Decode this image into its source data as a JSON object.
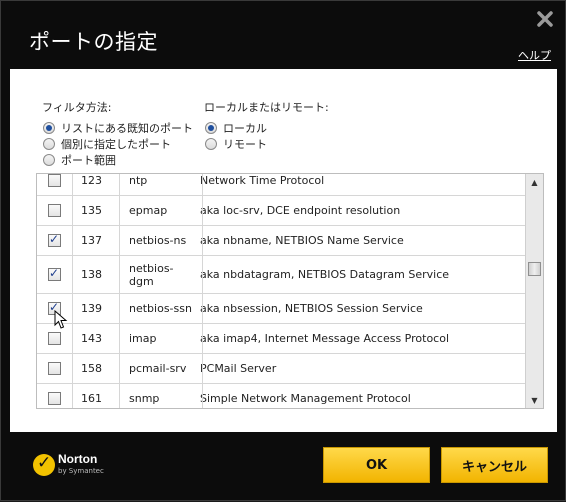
{
  "dialog": {
    "title": "ポートの指定",
    "help_label": "ヘルプ",
    "close_icon": "close-icon"
  },
  "filter": {
    "label": "フィルタ方法:",
    "options": [
      {
        "label": "リストにある既知のポート",
        "selected": true
      },
      {
        "label": "個別に指定したポート",
        "selected": false
      },
      {
        "label": "ポート範囲",
        "selected": false
      }
    ]
  },
  "scope": {
    "label": "ローカルまたはリモート:",
    "options": [
      {
        "label": "ローカル",
        "selected": true
      },
      {
        "label": "リモート",
        "selected": false
      }
    ]
  },
  "ports": [
    {
      "checked": false,
      "port": "123",
      "name": "ntp",
      "desc": "Network Time Protocol"
    },
    {
      "checked": false,
      "port": "135",
      "name": "epmap",
      "desc": "aka loc-srv, DCE endpoint resolution"
    },
    {
      "checked": true,
      "port": "137",
      "name": "netbios-ns",
      "desc": "aka nbname, NETBIOS Name Service"
    },
    {
      "checked": true,
      "port": "138",
      "name": "netbios-\ndgm",
      "desc": "aka nbdatagram, NETBIOS Datagram Service"
    },
    {
      "checked": true,
      "port": "139",
      "name": "netbios-ssn",
      "desc": "aka nbsession, NETBIOS Session Service"
    },
    {
      "checked": false,
      "port": "143",
      "name": "imap",
      "desc": "aka imap4, Internet Message Access Protocol"
    },
    {
      "checked": false,
      "port": "158",
      "name": "pcmail-srv",
      "desc": "PCMail Server"
    },
    {
      "checked": false,
      "port": "161",
      "name": "snmp",
      "desc": "Simple Network Management Protocol"
    }
  ],
  "footer": {
    "logo_brand": "Norton",
    "logo_sub": "by Symantec",
    "ok_label": "OK",
    "cancel_label": "キャンセル"
  },
  "colors": {
    "accent": "#f2b400",
    "title_bar": "#0c0c0c",
    "check": "#1f3f8e"
  }
}
